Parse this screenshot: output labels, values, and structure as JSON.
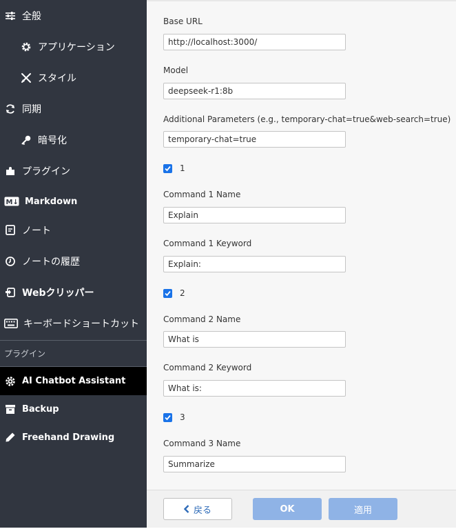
{
  "sidebar": {
    "items": [
      {
        "label": "全般",
        "icon": "sliders-icon"
      },
      {
        "label": "アプリケーション",
        "icon": "gear-icon"
      },
      {
        "label": "スタイル",
        "icon": "brush-icon"
      },
      {
        "label": "同期",
        "icon": "sync-icon"
      },
      {
        "label": "暗号化",
        "icon": "key-icon"
      },
      {
        "label": "プラグイン",
        "icon": "puzzle-icon"
      },
      {
        "label": "Markdown",
        "icon": "markdown-icon"
      },
      {
        "label": "ノート",
        "icon": "note-icon"
      },
      {
        "label": "ノートの履歴",
        "icon": "history-icon"
      },
      {
        "label": "Webクリッパー",
        "icon": "clipper-icon"
      },
      {
        "label": "キーボードショートカット",
        "icon": "keyboard-icon"
      }
    ],
    "plugins_heading": "プラグイン",
    "plugin_items": [
      {
        "label": "AI Chatbot Assistant",
        "icon": "gear-icon",
        "active": true
      },
      {
        "label": "Backup",
        "icon": "archive-icon"
      },
      {
        "label": "Freehand Drawing",
        "icon": "pen-icon"
      }
    ]
  },
  "form": {
    "base_url_label": "Base URL",
    "base_url_value": "http://localhost:3000/",
    "model_label": "Model",
    "model_value": "deepseek-r1:8b",
    "params_label": "Additional Parameters (e.g., temporary-chat=true&web-search=true)",
    "params_value": "temporary-chat=true",
    "check1_label": "1",
    "cmd1_name_label": "Command 1 Name",
    "cmd1_name_value": "Explain",
    "cmd1_kw_label": "Command 1 Keyword",
    "cmd1_kw_value": "Explain:",
    "check2_label": "2",
    "cmd2_name_label": "Command 2 Name",
    "cmd2_name_value": "What is",
    "cmd2_kw_label": "Command 2 Keyword",
    "cmd2_kw_value": "What is:",
    "check3_label": "3",
    "cmd3_name_label": "Command 3 Name",
    "cmd3_name_value": "Summarize"
  },
  "footer": {
    "back_label": "戻る",
    "ok_label": "OK",
    "apply_label": "適用"
  },
  "colors": {
    "sidebar_bg": "#313640",
    "active_bg": "#000000",
    "checkbox": "#1a73e8",
    "button_primary": "#8fb3e6"
  }
}
